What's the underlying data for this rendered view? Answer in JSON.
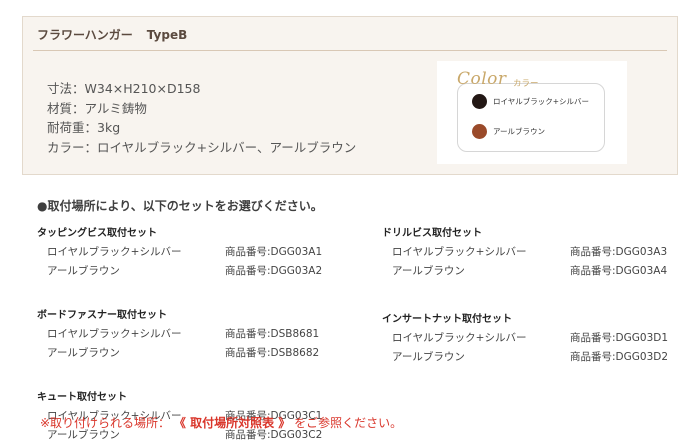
{
  "spec": {
    "title": "フラワーハンガー",
    "type": "TypeB",
    "lines": [
      "寸法：W34×H210×D158",
      "材質：アルミ鋳物",
      "耐荷重：3kg",
      "カラー：ロイヤルブラック+シルバー、アールブラウン"
    ]
  },
  "color_panel": {
    "word": "Color",
    "kana": "カラー",
    "swatches": [
      {
        "label": "ロイヤルブラック+シルバー",
        "color": "#231815"
      },
      {
        "label": "アールブラウン",
        "color": "#9a4a2a"
      }
    ]
  },
  "instruction": "●取付場所により、以下のセットをお選びください。",
  "product_prefix": "商品番号:",
  "left_groups": [
    {
      "title": "タッピングビス取付セット",
      "items": [
        {
          "name": "ロイヤルブラック+シルバー",
          "number": "DGG03A1"
        },
        {
          "name": "アールブラウン",
          "number": "DGG03A2"
        }
      ]
    },
    {
      "title": "ボードファスナー取付セット",
      "items": [
        {
          "name": "ロイヤルブラック+シルバー",
          "number": "DSB8681"
        },
        {
          "name": "アールブラウン",
          "number": "DSB8682"
        }
      ]
    },
    {
      "title": "キュート取付セット",
      "items": [
        {
          "name": "ロイヤルブラック+シルバー",
          "number": "DGG03C1"
        },
        {
          "name": "アールブラウン",
          "number": "DGG03C2"
        }
      ]
    }
  ],
  "right_groups": [
    {
      "title": "ドリルビス取付セット",
      "items": [
        {
          "name": "ロイヤルブラック+シルバー",
          "number": "DGG03A3"
        },
        {
          "name": "アールブラウン",
          "number": "DGG03A4"
        }
      ]
    },
    {
      "title": "インサートナット取付セット",
      "items": [
        {
          "name": "ロイヤルブラック+シルバー",
          "number": "DGG03D1"
        },
        {
          "name": "アールブラウン",
          "number": "DGG03D2"
        }
      ]
    }
  ],
  "footer": {
    "prefix": "※取り付けられる場所：",
    "link": "《 取付場所対照表 》",
    "suffix": "をご参照ください。"
  }
}
